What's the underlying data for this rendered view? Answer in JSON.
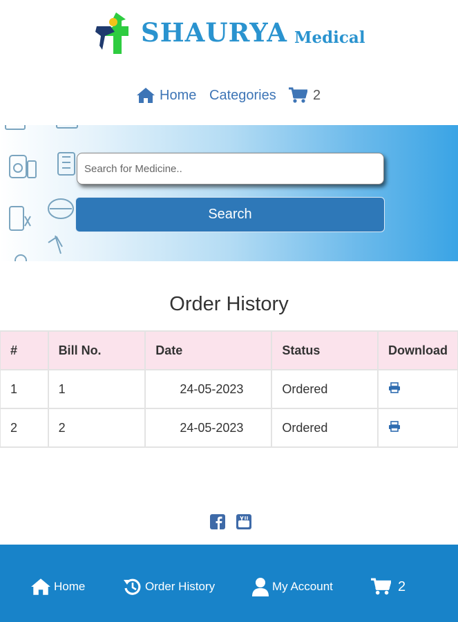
{
  "logo": {
    "brand": "SHAURYA",
    "brand_suffix": "Medical"
  },
  "nav": {
    "home": "Home",
    "categories": "Categories",
    "cart_count": "2"
  },
  "search": {
    "placeholder": "Search for Medicine..",
    "button": "Search"
  },
  "page_title": "Order History",
  "table": {
    "headers": [
      "#",
      "Bill No.",
      "Date",
      "Status",
      "Download"
    ],
    "rows": [
      {
        "index": "1",
        "bill": "1",
        "date": "24-05-2023",
        "status": "Ordered",
        "download_icon": "print-icon"
      },
      {
        "index": "2",
        "bill": "2",
        "date": "24-05-2023",
        "status": "Ordered",
        "download_icon": "print-icon"
      }
    ]
  },
  "social": [
    "facebook-icon",
    "youtube-icon"
  ],
  "footer": {
    "home": "Home",
    "order_history": "Order History",
    "my_account": "My Account",
    "cart_count": "2"
  },
  "colors": {
    "brand": "#2a93cf",
    "logo_green": "#2ecc40",
    "logo_navy": "#1f3a6e",
    "nav_link": "#3e75b6",
    "search_button": "#2e78b8",
    "table_header": "#fbe3ec",
    "footer": "#1883c9"
  }
}
